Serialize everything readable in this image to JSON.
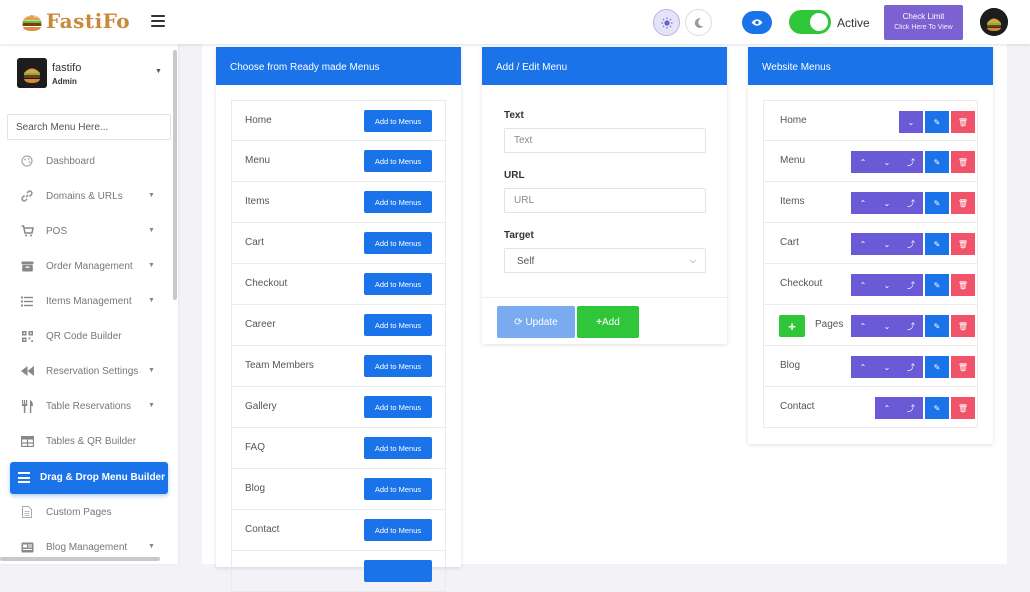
{
  "app": {
    "brand": "FastiFo"
  },
  "topbar": {
    "status_label": "Active",
    "check_limit": {
      "line1": "Check Limit",
      "line2": "Click Here To View"
    }
  },
  "sidebar": {
    "profile": {
      "name": "fastifo",
      "role": "Admin"
    },
    "search_placeholder": "Search Menu Here...",
    "items": [
      {
        "label": "Dashboard",
        "icon": "palette-icon"
      },
      {
        "label": "Domains & URLs",
        "icon": "link-icon"
      },
      {
        "label": "POS",
        "icon": "cart-icon"
      },
      {
        "label": "Order Management",
        "icon": "box-icon"
      },
      {
        "label": "Items Management",
        "icon": "list-icon"
      },
      {
        "label": "QR Code Builder",
        "icon": "qrcode-icon"
      },
      {
        "label": "Reservation Settings",
        "icon": "backward-icon"
      },
      {
        "label": "Table Reservations",
        "icon": "utensils-icon"
      },
      {
        "label": "Tables & QR Builder",
        "icon": "table-icon"
      },
      {
        "label": "Drag & Drop Menu Builder",
        "icon": "menu-icon"
      },
      {
        "label": "Custom Pages",
        "icon": "file-icon"
      },
      {
        "label": "Blog Management",
        "icon": "blog-icon"
      }
    ]
  },
  "ready_menus": {
    "title": "Choose from Ready made Menus",
    "button_label": "Add to Menus",
    "items": [
      "Home",
      "Menu",
      "Items",
      "Cart",
      "Checkout",
      "Career",
      "Team Members",
      "Gallery",
      "FAQ",
      "Blog",
      "Contact"
    ]
  },
  "edit_menu": {
    "title": "Add / Edit Menu",
    "text_label": "Text",
    "text_placeholder": "Text",
    "url_label": "URL",
    "url_placeholder": "URL",
    "target_label": "Target",
    "target_value": "Self",
    "update_label": "Update",
    "add_label": "Add"
  },
  "website_menus": {
    "title": "Website Menus",
    "items": [
      "Home",
      "Menu",
      "Items",
      "Cart",
      "Checkout",
      "Pages",
      "Blog",
      "Contact"
    ]
  },
  "colors": {
    "primary": "#1a73e8",
    "purple": "#6a5ad6",
    "success": "#2fc63a",
    "danger": "#f1546a",
    "brand": "#c8893b"
  }
}
